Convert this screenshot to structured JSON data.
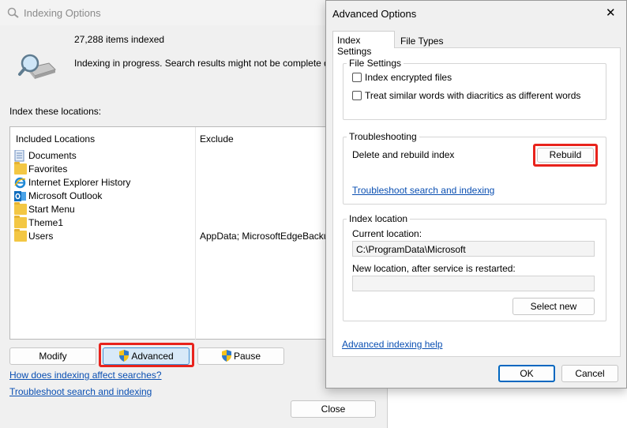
{
  "indexing_options": {
    "title": "Indexing Options",
    "items_indexed": "27,288 items indexed",
    "status_message": "Indexing in progress. Search results might not be complete during",
    "index_locations_label": "Index these locations:",
    "columns": {
      "included": "Included Locations",
      "exclude": "Exclude"
    },
    "locations": [
      {
        "name": "Documents",
        "icon": "documents-icon",
        "exclude": ""
      },
      {
        "name": "Favorites",
        "icon": "folder-icon",
        "exclude": ""
      },
      {
        "name": "Internet Explorer History",
        "icon": "internet-explorer-icon",
        "exclude": ""
      },
      {
        "name": "Microsoft Outlook",
        "icon": "outlook-icon",
        "exclude": ""
      },
      {
        "name": "Start Menu",
        "icon": "folder-icon",
        "exclude": ""
      },
      {
        "name": "Theme1",
        "icon": "folder-icon",
        "exclude": ""
      },
      {
        "name": "Users",
        "icon": "folder-icon",
        "exclude": "AppData; MicrosoftEdgeBackups;"
      }
    ],
    "buttons": {
      "modify": "Modify",
      "advanced": "Advanced",
      "pause": "Pause",
      "close": "Close"
    },
    "links": {
      "how_affect": "How does indexing affect searches?",
      "troubleshoot": "Troubleshoot search and indexing"
    }
  },
  "advanced_options": {
    "title": "Advanced Options",
    "close_glyph": "✕",
    "tabs": [
      {
        "label": "Index Settings",
        "active": true
      },
      {
        "label": "File Types",
        "active": false
      }
    ],
    "file_settings": {
      "title": "File Settings",
      "encrypt_label": "Index encrypted files",
      "encrypt_checked": false,
      "diacritics_label": "Treat similar words with diacritics as different words",
      "diacritics_checked": false
    },
    "troubleshooting": {
      "title": "Troubleshooting",
      "rebuild_text": "Delete and rebuild index",
      "rebuild_button": "Rebuild",
      "troubleshoot_link": "Troubleshoot search and indexing"
    },
    "index_location": {
      "title": "Index location",
      "current_label": "Current location:",
      "current_value": "C:\\ProgramData\\Microsoft",
      "new_label": "New location, after service is restarted:",
      "new_value": "",
      "select_new": "Select new"
    },
    "advanced_help_link": "Advanced indexing help",
    "ok": "OK",
    "cancel": "Cancel"
  },
  "colors": {
    "highlight": "#e8231c",
    "link": "#0a4fb2",
    "folder": "#f3c744",
    "ok_border": "#0067c0"
  }
}
